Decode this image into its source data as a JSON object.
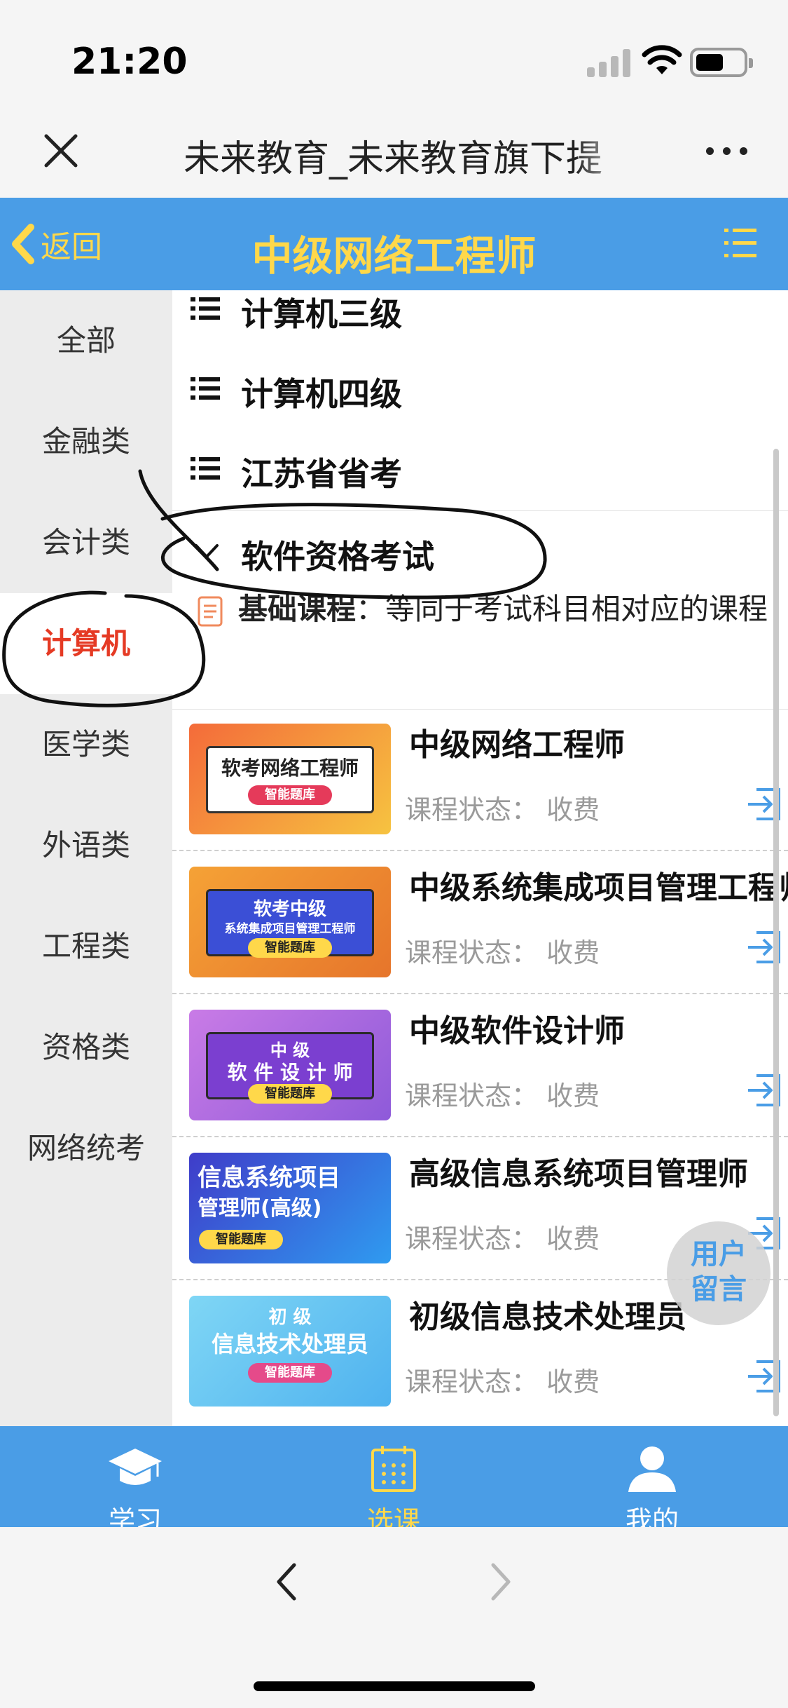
{
  "status_bar": {
    "time": "21:20"
  },
  "browser": {
    "page_title": "未来教育_未来教育旗下提"
  },
  "header": {
    "back_label": "返回",
    "title": "中级网络工程师"
  },
  "sidebar": {
    "items": [
      {
        "label": "全部"
      },
      {
        "label": "金融类"
      },
      {
        "label": "会计类"
      },
      {
        "label": "计算机"
      },
      {
        "label": "医学类"
      },
      {
        "label": "外语类"
      },
      {
        "label": "工程类"
      },
      {
        "label": "资格类"
      },
      {
        "label": "网络统考"
      }
    ],
    "active": "计算机"
  },
  "categories": [
    {
      "label": "计算机三级"
    },
    {
      "label": "计算机四级"
    },
    {
      "label": "江苏省省考"
    },
    {
      "label": "软件资格考试",
      "expanded": true
    }
  ],
  "basic_course": {
    "title": "基础课程",
    "desc": "：等同于考试科目相对应的课程"
  },
  "courses": [
    {
      "name": "中级网络工程师",
      "status": "课程状态：  收费",
      "thumb": {
        "line1": "软考网络工程师",
        "tag": "智能题库"
      }
    },
    {
      "name": "中级系统集成项目管理工程师",
      "status": "课程状态：  收费",
      "thumb": {
        "line1": "软考中级",
        "line2": "系统集成项目管理工程师",
        "tag": "智能题库"
      }
    },
    {
      "name": "中级软件设计师",
      "status": "课程状态：  收费",
      "thumb": {
        "line1": "中  级",
        "line2": "软 件 设 计 师",
        "tag": "智能题库"
      }
    },
    {
      "name": "高级信息系统项目管理师",
      "status": "课程状态：  收费",
      "thumb": {
        "line1": "信息系统项目",
        "line2": "管理师(高级)",
        "tag": "智能题库"
      }
    },
    {
      "name": "初级信息技术处理员",
      "status": "课程状态：  收费",
      "thumb": {
        "line1": "初  级",
        "line2": "信息技术处理员",
        "tag": "智能题库"
      }
    }
  ],
  "float_button": {
    "line1": "用户",
    "line2": "留言"
  },
  "tabs": [
    {
      "label": "学习",
      "icon": "graduation-cap-icon"
    },
    {
      "label": "选课",
      "icon": "grid-calendar-icon",
      "active": true
    },
    {
      "label": "我的",
      "icon": "user-icon"
    }
  ],
  "colors": {
    "accent": "#4a9de6",
    "highlight": "#ffd84a",
    "active_red": "#e53a24"
  }
}
